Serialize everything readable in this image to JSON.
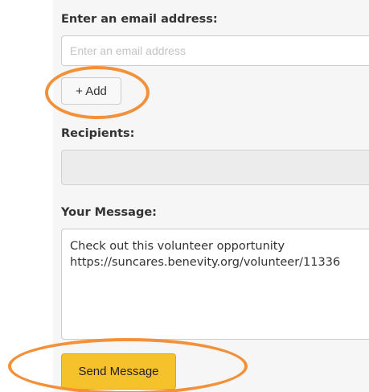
{
  "form": {
    "email_label": "Enter an email address:",
    "email_value": "",
    "email_placeholder": "Enter an email address",
    "add_label": "+ Add",
    "recipients_label": "Recipients:",
    "message_label": "Your Message:",
    "message_text": "Check out this volunteer opportunity\nhttps://suncares.benevity.org/volunteer/11336",
    "send_label": "Send Message"
  },
  "colors": {
    "send_button": "#f6c22c",
    "highlight_ring": "#f2913a"
  }
}
